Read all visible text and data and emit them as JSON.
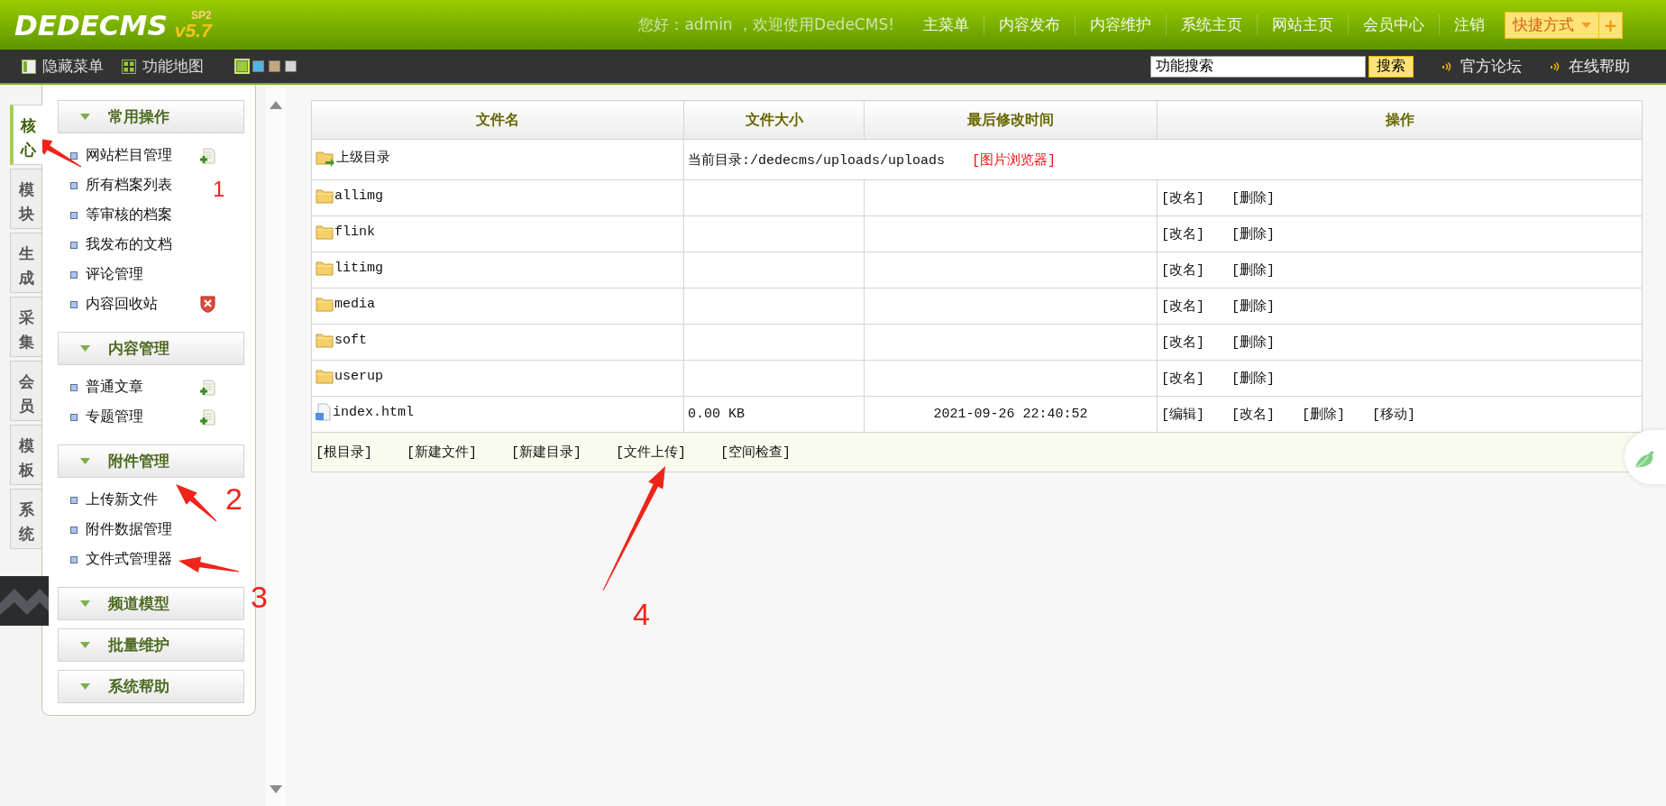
{
  "header": {
    "logo": "DEDECMS",
    "version": "v5.7",
    "edition": "SP2",
    "greeting": "您好：admin ，欢迎使用DedeCMS!",
    "nav": [
      "主菜单",
      "内容发布",
      "内容维护",
      "系统主页",
      "网站主页",
      "会员中心",
      "注销"
    ],
    "shortcut": {
      "label": "快捷方式",
      "plus": "+"
    }
  },
  "toolbar": {
    "links": [
      "隐藏菜单",
      "功能地图"
    ],
    "themes": [
      {
        "color": "#9acb34",
        "selected": true
      },
      {
        "color": "#4fb5e5",
        "selected": false
      },
      {
        "color": "#c2a87c",
        "selected": false
      },
      {
        "color": "#d2d6da",
        "selected": false
      }
    ],
    "search": {
      "value": "功能搜索",
      "button": "搜索"
    },
    "help_links": [
      "官方论坛",
      "在线帮助"
    ]
  },
  "side_tabs": [
    {
      "label": "核心",
      "selected": true
    },
    {
      "label": "模块",
      "selected": false
    },
    {
      "label": "生成",
      "selected": false
    },
    {
      "label": "采集",
      "selected": false
    },
    {
      "label": "会员",
      "selected": false
    },
    {
      "label": "模板",
      "selected": false
    },
    {
      "label": "系统",
      "selected": false
    }
  ],
  "menu": [
    {
      "title": "常用操作",
      "items": [
        {
          "label": "网站栏目管理",
          "kind": "add"
        },
        {
          "label": "所有档案列表",
          "kind": "plain"
        },
        {
          "label": "等审核的档案",
          "kind": "plain"
        },
        {
          "label": "我发布的文档",
          "kind": "plain"
        },
        {
          "label": "评论管理",
          "kind": "plain"
        },
        {
          "label": "内容回收站",
          "kind": "remove"
        }
      ]
    },
    {
      "title": "内容管理",
      "items": [
        {
          "label": "普通文章",
          "kind": "add"
        },
        {
          "label": "专题管理",
          "kind": "add"
        }
      ]
    },
    {
      "title": "附件管理",
      "items": [
        {
          "label": "上传新文件",
          "kind": "plain"
        },
        {
          "label": "附件数据管理",
          "kind": "plain"
        },
        {
          "label": "文件式管理器",
          "kind": "plain"
        }
      ]
    },
    {
      "title": "频道模型"
    },
    {
      "title": "批量维护"
    },
    {
      "title": "系统帮助"
    }
  ],
  "table": {
    "columns": [
      "文件名",
      "文件大小",
      "最后修改时间",
      "操作"
    ],
    "parent_row": {
      "name": "上级目录",
      "path": "当前目录:/dedecms/uploads/uploads",
      "viewer": "[图片浏览器]"
    },
    "rows": [
      {
        "kind": "folder",
        "name": "allimg",
        "actions": [
          "[改名]",
          "[删除]"
        ]
      },
      {
        "kind": "folder",
        "name": "flink",
        "actions": [
          "[改名]",
          "[删除]"
        ]
      },
      {
        "kind": "folder",
        "name": "litimg",
        "actions": [
          "[改名]",
          "[删除]"
        ]
      },
      {
        "kind": "folder",
        "name": "media",
        "actions": [
          "[改名]",
          "[删除]"
        ]
      },
      {
        "kind": "folder",
        "name": "soft",
        "actions": [
          "[改名]",
          "[删除]"
        ]
      },
      {
        "kind": "folder",
        "name": "userup",
        "actions": [
          "[改名]",
          "[删除]"
        ]
      },
      {
        "kind": "file",
        "name": "index.html",
        "size": "0.00 KB",
        "modified": "2021-09-26 22:40:52",
        "actions": [
          "[编辑]",
          "[改名]",
          "[删除]",
          "[移动]"
        ]
      }
    ],
    "footer_links": [
      "[根目录]",
      "[新建文件]",
      "[新建目录]",
      "[文件上传]",
      "[空间检查]"
    ]
  },
  "annotations": [
    "1",
    "2",
    "3",
    "4"
  ]
}
